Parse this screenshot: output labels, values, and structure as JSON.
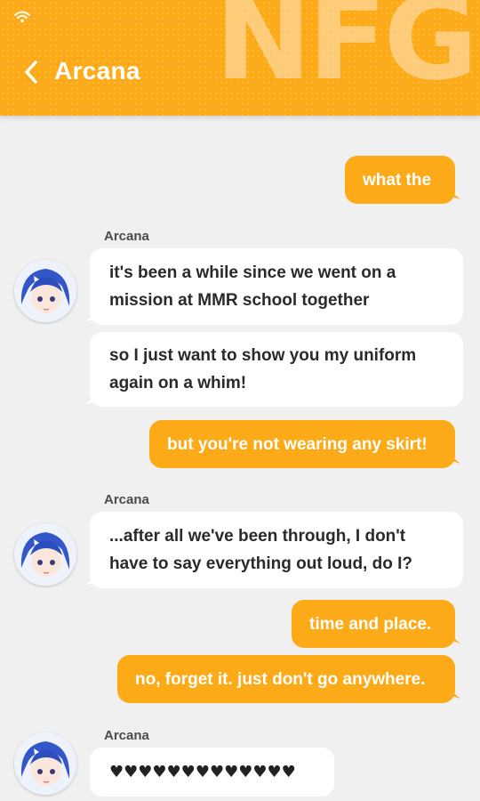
{
  "header": {
    "title": "Arcana",
    "watermark": "NFG",
    "back_icon": "chevron-left-icon",
    "status_icon": "wifi-icon",
    "accent_color": "#fdaa18"
  },
  "messages": {
    "m1": {
      "text": "what the"
    },
    "s1": {
      "sender": "Arcana"
    },
    "m2": {
      "text": "it's been a while since we went on a mission at MMR school together"
    },
    "m3": {
      "text": "so I just want to show you my uniform again on a whim!"
    },
    "m4": {
      "text": "but you're not wearing any skirt!"
    },
    "s2": {
      "sender": "Arcana"
    },
    "m5": {
      "text": "...after all we've been through, I don't have to say everything out loud, do I?"
    },
    "m6": {
      "text": "time and place."
    },
    "m7": {
      "text": "no, forget it. just don't go anywhere."
    },
    "s3": {
      "sender": "Arcana"
    },
    "m8": {
      "text": "♥♥♥♥♥♥♥♥♥♥♥♥♥"
    }
  }
}
